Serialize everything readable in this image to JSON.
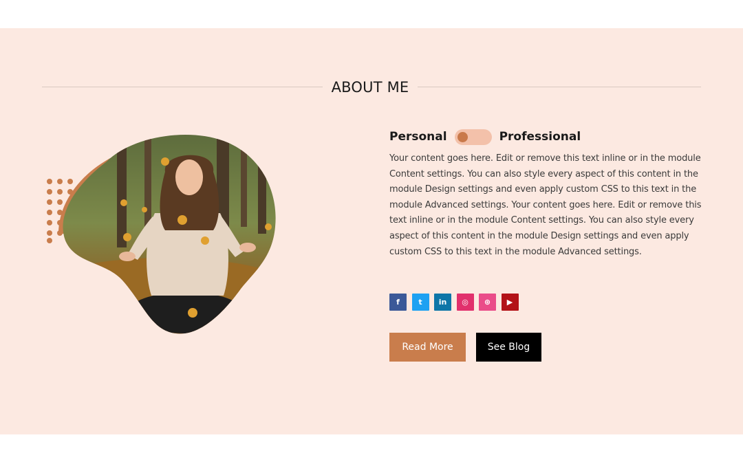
{
  "section": {
    "title": "ABOUT ME",
    "colors": {
      "background": "#fce9e1",
      "accent": "#c97d4c",
      "dark_button": "#000000"
    }
  },
  "toggle": {
    "left_label": "Personal",
    "right_label": "Professional",
    "state": "personal"
  },
  "content": {
    "paragraph": "Your content goes here. Edit or remove this text inline or in the module Content settings. You can also style every aspect of this content in the module Design settings and even apply custom CSS to this text in the module Advanced settings. Your content goes here. Edit or remove this text inline or in the module Content settings. You can also style every aspect of this content in the module Design settings and even apply custom CSS to this text in the module Advanced settings."
  },
  "social": [
    {
      "icon": "facebook-icon",
      "glyph": "f",
      "color": "#3b5998"
    },
    {
      "icon": "twitter-icon",
      "glyph": "t",
      "color": "#1da1f2"
    },
    {
      "icon": "linkedin-icon",
      "glyph": "in",
      "color": "#0e76a8"
    },
    {
      "icon": "instagram-icon",
      "glyph": "◎",
      "color": "#e1306c"
    },
    {
      "icon": "dribbble-icon",
      "glyph": "⊛",
      "color": "#ea4c89"
    },
    {
      "icon": "youtube-icon",
      "glyph": "▶",
      "color": "#b31217"
    }
  ],
  "buttons": {
    "read_more": "Read More",
    "see_blog": "See Blog"
  }
}
